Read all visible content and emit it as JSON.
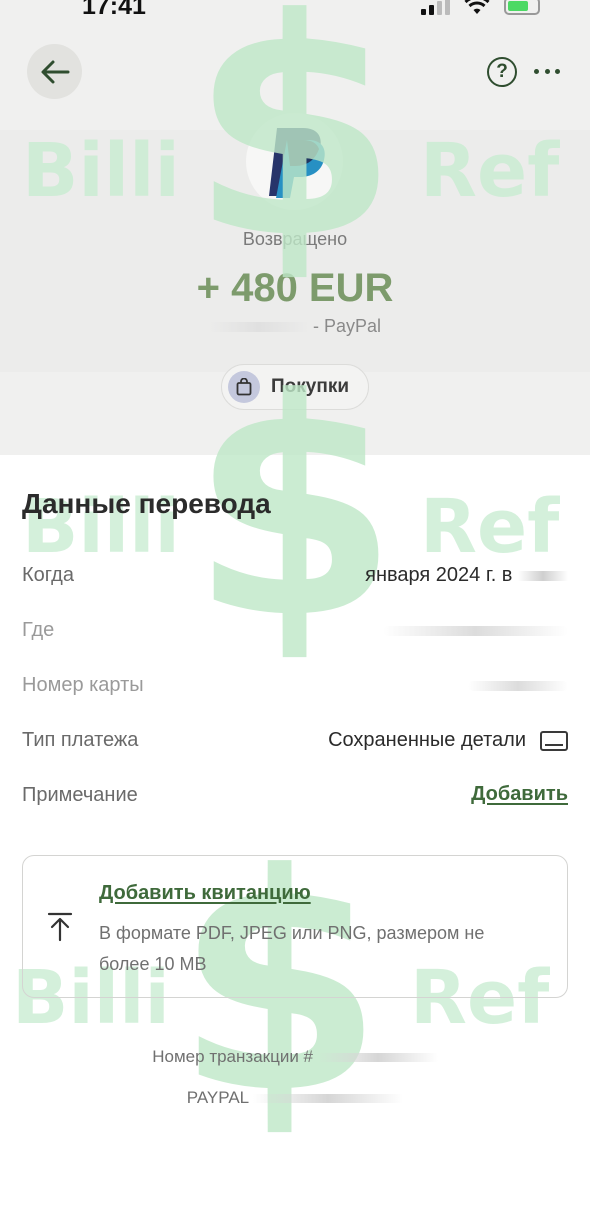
{
  "status_bar": {
    "time": "17:41"
  },
  "transaction": {
    "status": "Возвращено",
    "amount": "+ 480 EUR",
    "merchant": "- PayPal",
    "category": "Покупки"
  },
  "watermark": {
    "left_text": "Billi",
    "right_text": "Ref",
    "symbol": "$"
  },
  "details": {
    "title": "Данные перевода",
    "rows": {
      "when": {
        "label": "Когда",
        "value": "января 2024 г. в"
      },
      "where": {
        "label": "Где"
      },
      "card": {
        "label": "Номер карты"
      },
      "payment_type": {
        "label": "Тип платежа",
        "value": "Сохраненные детали"
      },
      "note": {
        "label": "Примечание",
        "action": "Добавить"
      }
    }
  },
  "receipt": {
    "title": "Добавить квитанцию",
    "description": "В формате PDF, JPEG или PNG, размером не более 10 MB"
  },
  "footer": {
    "transaction_number": "Номер транзакции #",
    "reference": "PAYPAL"
  },
  "colors": {
    "accent_green": "#3f6a3b",
    "amount_green": "#7d9b6c",
    "header_bg": "#f0f0ef"
  }
}
